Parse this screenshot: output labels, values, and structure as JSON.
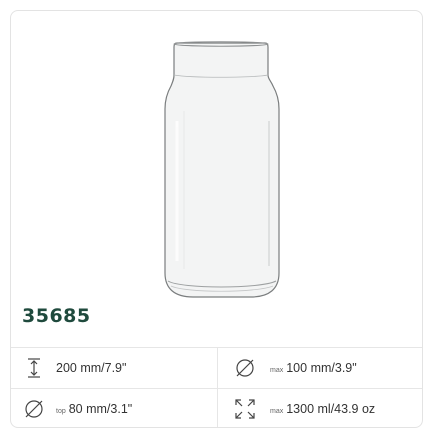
{
  "product": {
    "code": "35685"
  },
  "specs": {
    "height": {
      "icon": "height-arrows-icon",
      "value": "200 mm/7.9\""
    },
    "max_diameter": {
      "icon": "diameter-icon",
      "prefix": "max",
      "value": "100 mm/3.9\""
    },
    "top_diameter": {
      "icon": "diameter-icon",
      "prefix": "top",
      "value": "80 mm/3.1\""
    },
    "capacity": {
      "icon": "expand-arrows-icon",
      "prefix": "max",
      "value": "1300 ml/43.9 oz"
    }
  },
  "colors": {
    "code_text": "#1f4a3d",
    "border": "#e3e3e3"
  }
}
